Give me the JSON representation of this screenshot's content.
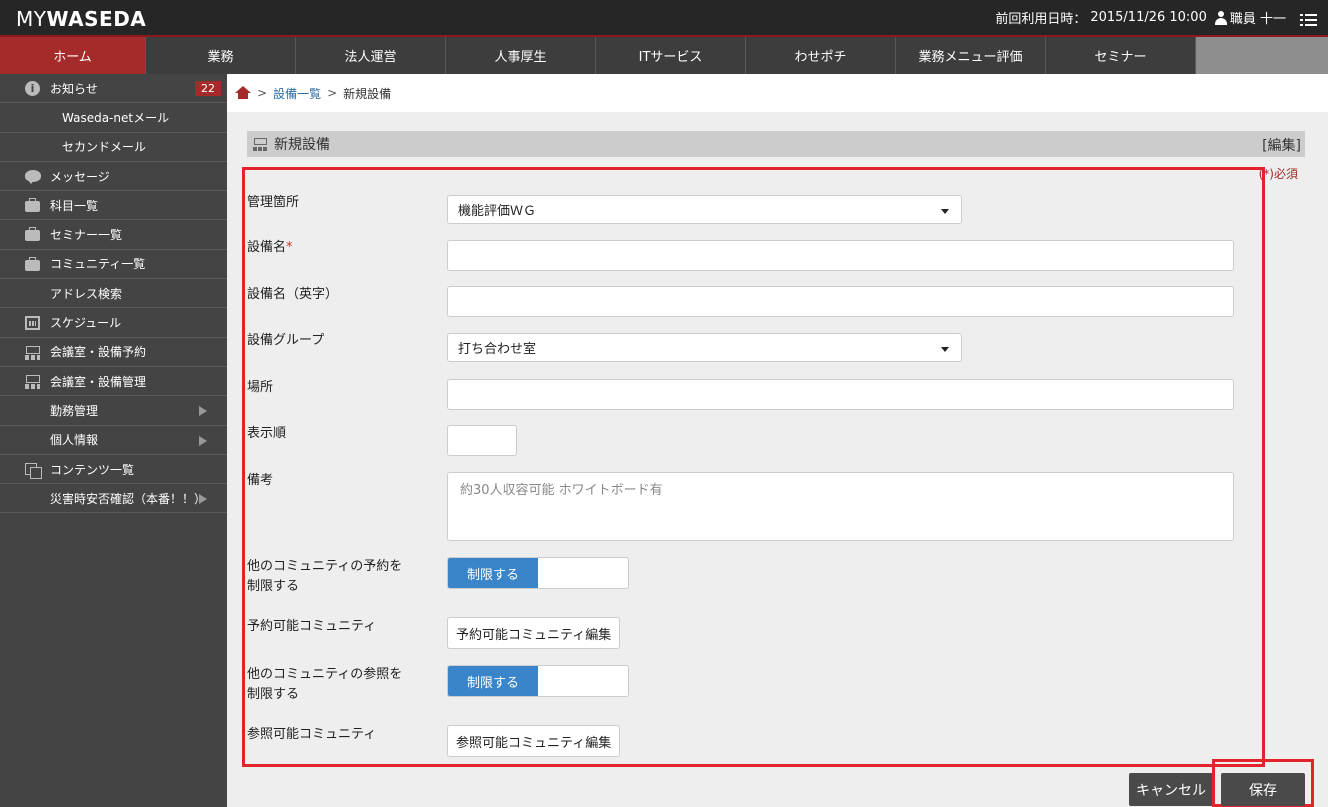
{
  "header": {
    "logo_my": "MY",
    "logo_waseda": "WASEDA",
    "last_login_label": "前回利用日時：",
    "last_login_value": "2015/11/26 10:00",
    "user_name": "職員 十一"
  },
  "nav": {
    "items": [
      "ホーム",
      "業務",
      "法人運営",
      "人事厚生",
      "ITサービス",
      "わせポチ",
      "業務メニュー評価",
      "セミナー"
    ]
  },
  "sidebar": {
    "notice": {
      "label": "お知らせ",
      "count": "22"
    },
    "waseda_mail": "Waseda-netメール",
    "second_mail": "セカンドメール",
    "message": "メッセージ",
    "subjects": "科目一覧",
    "seminars": "セミナー一覧",
    "communities": "コミュニティ一覧",
    "address": "アドレス検索",
    "schedule": "スケジュール",
    "room_reserve": "会議室・設備予約",
    "room_manage": "会議室・設備管理",
    "attendance": "勤務管理",
    "personal": "個人情報",
    "contents": "コンテンツ一覧",
    "disaster": "災害時安否確認（本番！！）"
  },
  "breadcrumb": {
    "sep": ">",
    "link": "設備一覧",
    "current": "新規設備"
  },
  "section": {
    "title": "新規設備",
    "edit": "[編集]",
    "required_note": "(*)必須"
  },
  "form": {
    "manage_location_label": "管理箇所",
    "manage_location_value": "機能評価ＷＧ",
    "equipment_name_label": "設備名",
    "required_star": "*",
    "equipment_name_en_label": "設備名（英字）",
    "group_label": "設備グループ",
    "group_value": "打ち合わせ室",
    "place_label": "場所",
    "order_label": "表示順",
    "notes_label": "備考",
    "notes_placeholder": "約30人収容可能 ホワイトボード有",
    "restrict_reserve_label_1": "他のコミュニティの予約を",
    "restrict_reserve_label_2": "制限する",
    "restrict_on": "制限する",
    "reserve_community_label": "予約可能コミュニティ",
    "reserve_community_button": "予約可能コミュニティ編集",
    "restrict_view_label_1": "他のコミュニティの参照を",
    "restrict_view_label_2": "制限する",
    "view_community_label": "参照可能コミュニティ",
    "view_community_button": "参照可能コミュニティ編集"
  },
  "actions": {
    "cancel": "キャンセル",
    "save": "保存"
  },
  "colors": {
    "brand": "#a52a2a",
    "toggle_on": "#3a85c9",
    "highlight": "#e3232b"
  }
}
